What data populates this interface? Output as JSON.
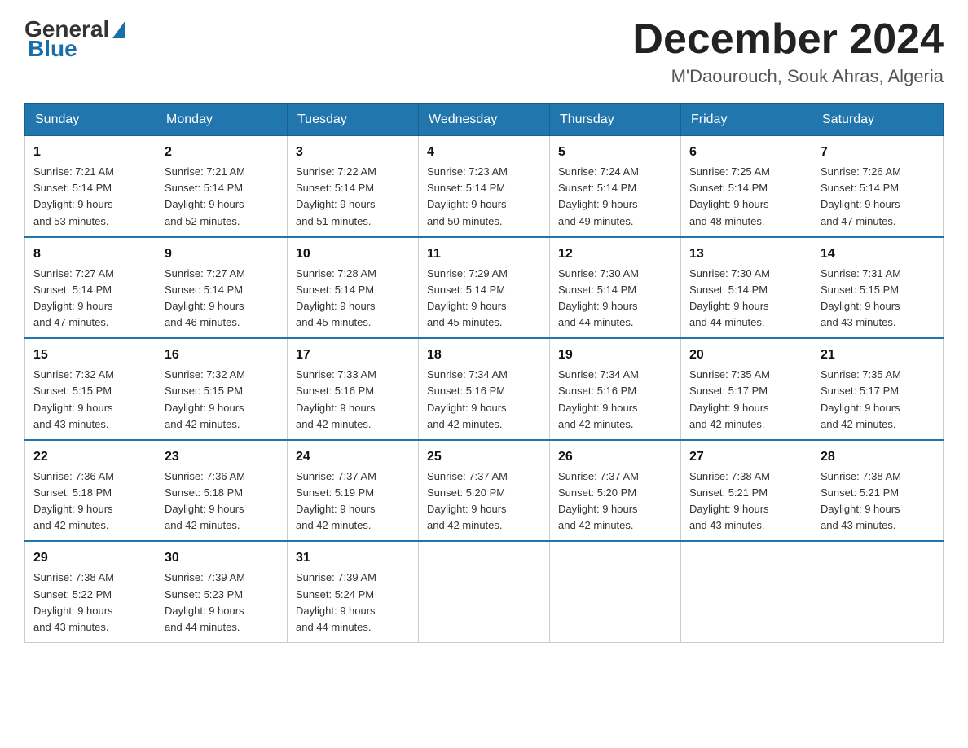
{
  "header": {
    "logo_general": "General",
    "logo_blue": "Blue",
    "month_title": "December 2024",
    "location": "M'Daourouch, Souk Ahras, Algeria"
  },
  "days_of_week": [
    "Sunday",
    "Monday",
    "Tuesday",
    "Wednesday",
    "Thursday",
    "Friday",
    "Saturday"
  ],
  "weeks": [
    [
      {
        "day": "1",
        "sunrise": "7:21 AM",
        "sunset": "5:14 PM",
        "daylight": "9 hours and 53 minutes."
      },
      {
        "day": "2",
        "sunrise": "7:21 AM",
        "sunset": "5:14 PM",
        "daylight": "9 hours and 52 minutes."
      },
      {
        "day": "3",
        "sunrise": "7:22 AM",
        "sunset": "5:14 PM",
        "daylight": "9 hours and 51 minutes."
      },
      {
        "day": "4",
        "sunrise": "7:23 AM",
        "sunset": "5:14 PM",
        "daylight": "9 hours and 50 minutes."
      },
      {
        "day": "5",
        "sunrise": "7:24 AM",
        "sunset": "5:14 PM",
        "daylight": "9 hours and 49 minutes."
      },
      {
        "day": "6",
        "sunrise": "7:25 AM",
        "sunset": "5:14 PM",
        "daylight": "9 hours and 48 minutes."
      },
      {
        "day": "7",
        "sunrise": "7:26 AM",
        "sunset": "5:14 PM",
        "daylight": "9 hours and 47 minutes."
      }
    ],
    [
      {
        "day": "8",
        "sunrise": "7:27 AM",
        "sunset": "5:14 PM",
        "daylight": "9 hours and 47 minutes."
      },
      {
        "day": "9",
        "sunrise": "7:27 AM",
        "sunset": "5:14 PM",
        "daylight": "9 hours and 46 minutes."
      },
      {
        "day": "10",
        "sunrise": "7:28 AM",
        "sunset": "5:14 PM",
        "daylight": "9 hours and 45 minutes."
      },
      {
        "day": "11",
        "sunrise": "7:29 AM",
        "sunset": "5:14 PM",
        "daylight": "9 hours and 45 minutes."
      },
      {
        "day": "12",
        "sunrise": "7:30 AM",
        "sunset": "5:14 PM",
        "daylight": "9 hours and 44 minutes."
      },
      {
        "day": "13",
        "sunrise": "7:30 AM",
        "sunset": "5:14 PM",
        "daylight": "9 hours and 44 minutes."
      },
      {
        "day": "14",
        "sunrise": "7:31 AM",
        "sunset": "5:15 PM",
        "daylight": "9 hours and 43 minutes."
      }
    ],
    [
      {
        "day": "15",
        "sunrise": "7:32 AM",
        "sunset": "5:15 PM",
        "daylight": "9 hours and 43 minutes."
      },
      {
        "day": "16",
        "sunrise": "7:32 AM",
        "sunset": "5:15 PM",
        "daylight": "9 hours and 42 minutes."
      },
      {
        "day": "17",
        "sunrise": "7:33 AM",
        "sunset": "5:16 PM",
        "daylight": "9 hours and 42 minutes."
      },
      {
        "day": "18",
        "sunrise": "7:34 AM",
        "sunset": "5:16 PM",
        "daylight": "9 hours and 42 minutes."
      },
      {
        "day": "19",
        "sunrise": "7:34 AM",
        "sunset": "5:16 PM",
        "daylight": "9 hours and 42 minutes."
      },
      {
        "day": "20",
        "sunrise": "7:35 AM",
        "sunset": "5:17 PM",
        "daylight": "9 hours and 42 minutes."
      },
      {
        "day": "21",
        "sunrise": "7:35 AM",
        "sunset": "5:17 PM",
        "daylight": "9 hours and 42 minutes."
      }
    ],
    [
      {
        "day": "22",
        "sunrise": "7:36 AM",
        "sunset": "5:18 PM",
        "daylight": "9 hours and 42 minutes."
      },
      {
        "day": "23",
        "sunrise": "7:36 AM",
        "sunset": "5:18 PM",
        "daylight": "9 hours and 42 minutes."
      },
      {
        "day": "24",
        "sunrise": "7:37 AM",
        "sunset": "5:19 PM",
        "daylight": "9 hours and 42 minutes."
      },
      {
        "day": "25",
        "sunrise": "7:37 AM",
        "sunset": "5:20 PM",
        "daylight": "9 hours and 42 minutes."
      },
      {
        "day": "26",
        "sunrise": "7:37 AM",
        "sunset": "5:20 PM",
        "daylight": "9 hours and 42 minutes."
      },
      {
        "day": "27",
        "sunrise": "7:38 AM",
        "sunset": "5:21 PM",
        "daylight": "9 hours and 43 minutes."
      },
      {
        "day": "28",
        "sunrise": "7:38 AM",
        "sunset": "5:21 PM",
        "daylight": "9 hours and 43 minutes."
      }
    ],
    [
      {
        "day": "29",
        "sunrise": "7:38 AM",
        "sunset": "5:22 PM",
        "daylight": "9 hours and 43 minutes."
      },
      {
        "day": "30",
        "sunrise": "7:39 AM",
        "sunset": "5:23 PM",
        "daylight": "9 hours and 44 minutes."
      },
      {
        "day": "31",
        "sunrise": "7:39 AM",
        "sunset": "5:24 PM",
        "daylight": "9 hours and 44 minutes."
      },
      null,
      null,
      null,
      null
    ]
  ]
}
